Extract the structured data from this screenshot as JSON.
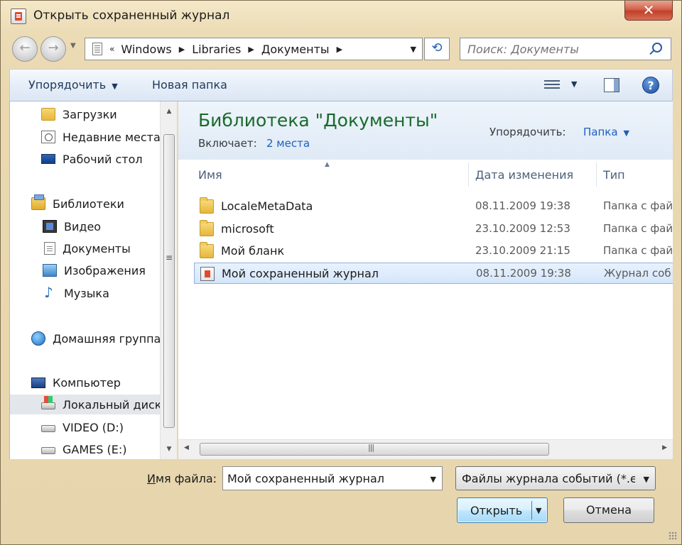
{
  "window": {
    "title": "Открыть сохраненный журнал",
    "close_glyph": "✕"
  },
  "nav": {
    "back_glyph": "←",
    "forward_glyph": "→",
    "breadcrumb_prefix": "«",
    "breadcrumb": [
      "Windows",
      "Libraries",
      "Документы"
    ],
    "refresh_glyph": "⟲",
    "search_placeholder": "Поиск: Документы"
  },
  "toolbar": {
    "organize_label": "Упорядочить",
    "new_folder_label": "Новая папка",
    "help_glyph": "?"
  },
  "sidebar": {
    "items": [
      {
        "label": "Загрузки",
        "icon": "downloads-folder-icon"
      },
      {
        "label": "Недавние места",
        "icon": "recent-places-icon"
      },
      {
        "label": "Рабочий стол",
        "icon": "desktop-icon"
      },
      {
        "label": "Библиотеки",
        "icon": "libraries-icon"
      },
      {
        "label": "Видео",
        "icon": "videos-icon"
      },
      {
        "label": "Документы",
        "icon": "documents-icon"
      },
      {
        "label": "Изображения",
        "icon": "pictures-icon"
      },
      {
        "label": "Музыка",
        "icon": "music-icon"
      },
      {
        "label": "Домашняя группа",
        "icon": "homegroup-icon"
      },
      {
        "label": "Компьютер",
        "icon": "computer-icon"
      },
      {
        "label": "Локальный диск",
        "icon": "local-disk-icon"
      },
      {
        "label": "VIDEO (D:)",
        "icon": "drive-icon"
      },
      {
        "label": "GAMES (E:)",
        "icon": "drive-icon"
      }
    ]
  },
  "library": {
    "title": "Библиотека \"Документы\"",
    "includes_label": "Включает:",
    "includes_link": "2 места",
    "arrange_label": "Упорядочить:",
    "arrange_value": "Папка"
  },
  "columns": {
    "name": "Имя",
    "date": "Дата изменения",
    "type": "Тип"
  },
  "files": [
    {
      "name": "LocaleMetaData",
      "date": "08.11.2009 19:38",
      "type": "Папка с фай",
      "icon": "folder-icon"
    },
    {
      "name": "microsoft",
      "date": "23.10.2009 12:53",
      "type": "Папка с фай",
      "icon": "folder-icon"
    },
    {
      "name": "Мой бланк",
      "date": "23.10.2009 21:15",
      "type": "Папка с фай",
      "icon": "folder-icon"
    },
    {
      "name": "Мой сохраненный журнал",
      "date": "08.11.2009 19:38",
      "type": "Журнал соб",
      "icon": "event-log-icon",
      "selected": true
    }
  ],
  "footer": {
    "filename_label_accel": "И",
    "filename_label_rest": "мя файла:",
    "filename_value": "Мой сохраненный журнал",
    "filter_value": "Файлы журнала событий (*.e",
    "open_label": "Открыть",
    "cancel_label": "Отмена"
  }
}
